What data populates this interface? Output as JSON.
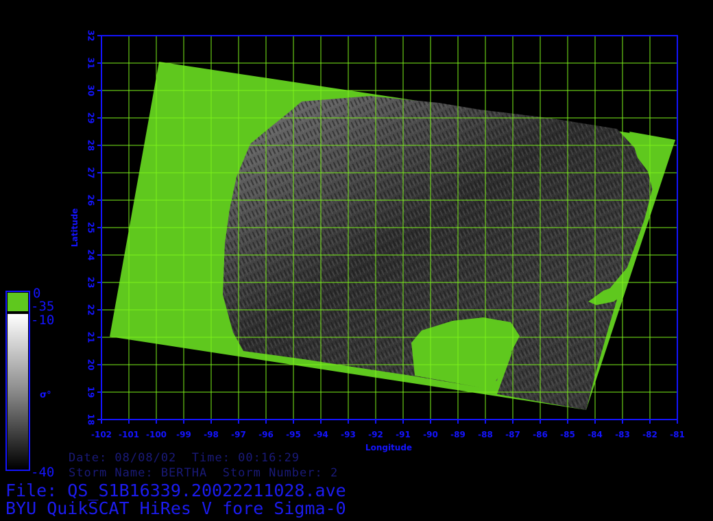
{
  "map": {
    "xlabel": "Longitude",
    "ylabel": "Latitude",
    "lon_range": [
      -102,
      -81
    ],
    "lat_range": [
      18,
      32
    ],
    "lon_ticks": [
      "-102",
      "-101",
      "-100",
      "-99",
      "-98",
      "-97",
      "-96",
      "-95",
      "-94",
      "-93",
      "-92",
      "-91",
      "-90",
      "-89",
      "-88",
      "-87",
      "-86",
      "-85",
      "-84",
      "-83",
      "-82",
      "-81"
    ],
    "lat_ticks": [
      "18",
      "19",
      "20",
      "21",
      "22",
      "23",
      "24",
      "25",
      "26",
      "27",
      "28",
      "29",
      "30",
      "31",
      "32"
    ],
    "grid": true,
    "colors": {
      "axis": "#1414ff",
      "grid": "#7cf21a",
      "land": "#5fc81e",
      "ocean_dark": "#262626",
      "ocean_light": "#8c8c8c"
    }
  },
  "colorbar": {
    "labels": [
      "0",
      "-35",
      "-10",
      "-40"
    ],
    "symbol": "σ°"
  },
  "info": {
    "date_line": "Date: 08/08/02  Time: 00:16:29",
    "storm_line": "Storm Name: BERTHA  Storm Number: 2",
    "file_line": "File: QS_S1B16339.20022211028.ave",
    "product_line": "BYU QuikSCAT HiRes V fore Sigma-0"
  }
}
